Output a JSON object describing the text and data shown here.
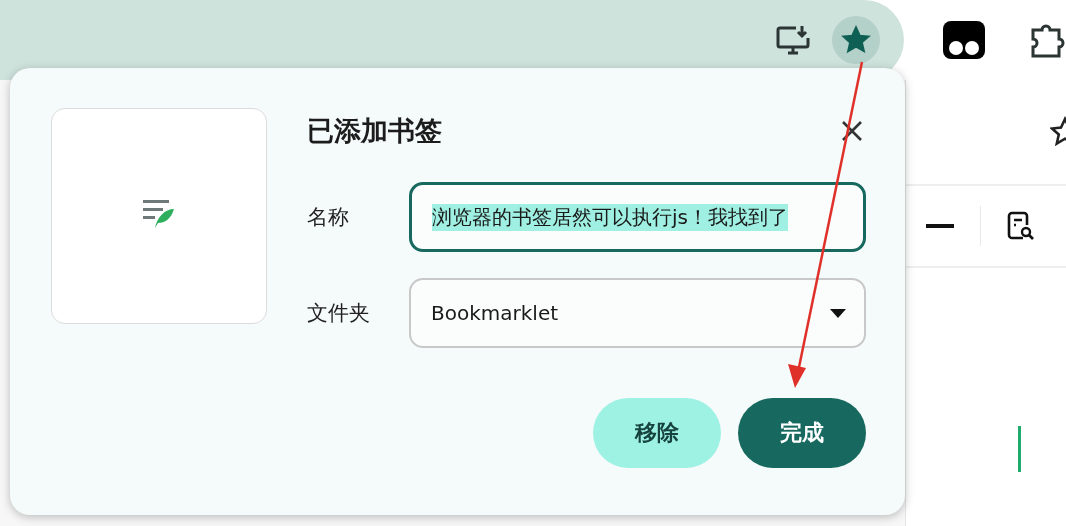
{
  "toolbar": {
    "star_button": {
      "bookmarked": true
    }
  },
  "dialog": {
    "title": "已添加书签",
    "fields": [
      {
        "kind": "text",
        "label": "名称",
        "value": "浏览器的书签居然可以执行js！我找到了",
        "focused": true
      },
      {
        "kind": "select",
        "label": "文件夹",
        "value": "Bookmarklet",
        "focused": false
      }
    ],
    "buttons": [
      {
        "label": "移除",
        "primary": false
      },
      {
        "label": "完成",
        "primary": true
      }
    ]
  }
}
